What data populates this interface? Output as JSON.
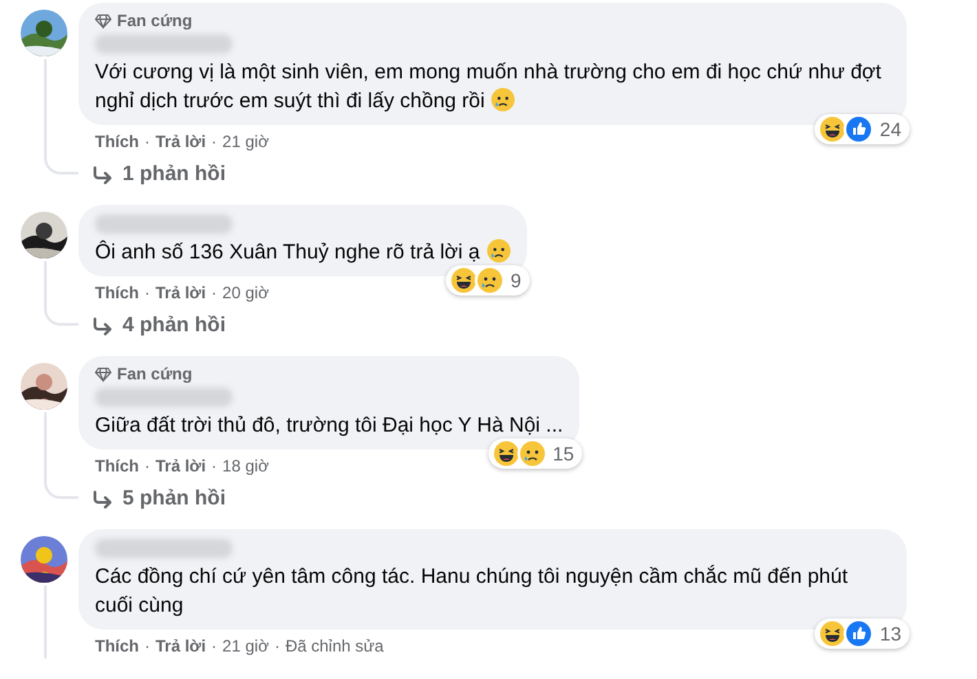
{
  "separator": "·",
  "comments": [
    {
      "avatar": {
        "kind": "picture"
      },
      "badge": "Fan cứng",
      "text": "Với cương vị là một sinh viên, em mong muốn nhà trường cho em đi học chứ như đợt nghỉ dịch trước em suýt thì đi lấy chồng rồi",
      "end_emoji": {
        "kind": "sad"
      },
      "actions": [
        "Thích",
        "Trả lời",
        "21 giờ"
      ],
      "reactions": {
        "icons": [
          {
            "kind": "haha"
          },
          {
            "kind": "like"
          }
        ],
        "count": "24"
      },
      "replies": "1 phản hồi"
    },
    {
      "avatar": {
        "kind": "picture"
      },
      "text": "Ôi anh số 136 Xuân Thuỷ nghe rõ trả lời ạ",
      "end_emoji": {
        "kind": "sad"
      },
      "actions": [
        "Thích",
        "Trả lời",
        "20 giờ"
      ],
      "reactions": {
        "icons": [
          {
            "kind": "haha"
          },
          {
            "kind": "sad"
          }
        ],
        "count": "9"
      },
      "replies": "4 phản hồi"
    },
    {
      "avatar": {
        "kind": "picture"
      },
      "badge": "Fan cứng",
      "text": "Giữa đất trời thủ đô, trường tôi Đại học Y Hà Nội ...",
      "actions": [
        "Thích",
        "Trả lời",
        "18 giờ"
      ],
      "reactions": {
        "icons": [
          {
            "kind": "haha"
          },
          {
            "kind": "sad"
          }
        ],
        "count": "15"
      },
      "replies": "5 phản hồi"
    },
    {
      "avatar": {
        "kind": "picture"
      },
      "text": "Các đồng chí cứ yên tâm công tác. Hanu chúng tôi nguyện cầm chắc mũ đến phút cuối cùng",
      "actions": [
        "Thích",
        "Trả lời",
        "21 giờ",
        "Đã chỉnh sửa"
      ],
      "reactions": {
        "icons": [
          {
            "kind": "haha"
          },
          {
            "kind": "like"
          }
        ],
        "count": "13"
      }
    }
  ]
}
